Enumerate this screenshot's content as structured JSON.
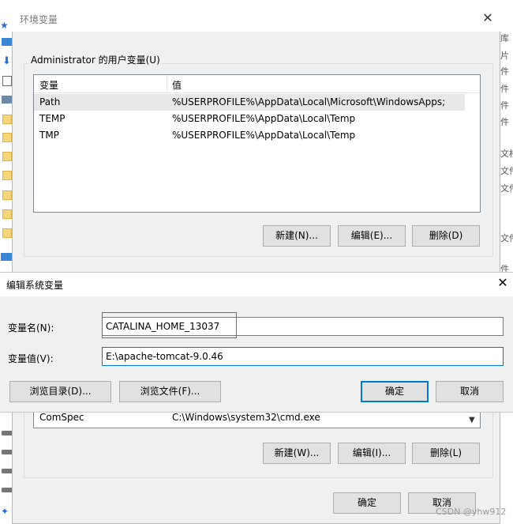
{
  "env_dialog": {
    "title": "环境变量",
    "user_group_label": "Administrator 的用户变量(U)",
    "user_vars": {
      "columns": [
        "变量",
        "值"
      ],
      "rows": [
        {
          "name": "Path",
          "value": "%USERPROFILE%\\AppData\\Local\\Microsoft\\WindowsApps;"
        },
        {
          "name": "TEMP",
          "value": "%USERPROFILE%\\AppData\\Local\\Temp"
        },
        {
          "name": "TMP",
          "value": "%USERPROFILE%\\AppData\\Local\\Temp"
        }
      ],
      "buttons": {
        "new": "新建(N)...",
        "edit": "编辑(E)...",
        "delete": "删除(D)"
      }
    },
    "system_vars": {
      "visible_row": {
        "name": "ComSpec",
        "value": "C:\\Windows\\system32\\cmd.exe"
      },
      "buttons": {
        "new": "新建(W)...",
        "edit": "编辑(I)...",
        "delete": "删除(L)"
      }
    },
    "footer": {
      "ok": "确定",
      "cancel": "取消"
    }
  },
  "edit_dialog": {
    "title": "编辑系统变量",
    "name_label": "变量名(N):",
    "name_value": "CATALINA_HOME_13037",
    "value_label": "变量值(V):",
    "value_value": "E:\\apache-tomcat-9.0.46",
    "buttons": {
      "browse_dir": "浏览目录(D)...",
      "browse_file": "浏览文件(F)...",
      "ok": "确定",
      "cancel": "取消"
    }
  },
  "background_right_texts": [
    "库",
    "片",
    "件",
    "件",
    "件",
    "件",
    "文档",
    "文件",
    "文件",
    "文件",
    "件"
  ],
  "watermark": "CSDN @yhw912",
  "colors": {
    "accent": "#0078d7",
    "highlight": "#e23b3b"
  }
}
